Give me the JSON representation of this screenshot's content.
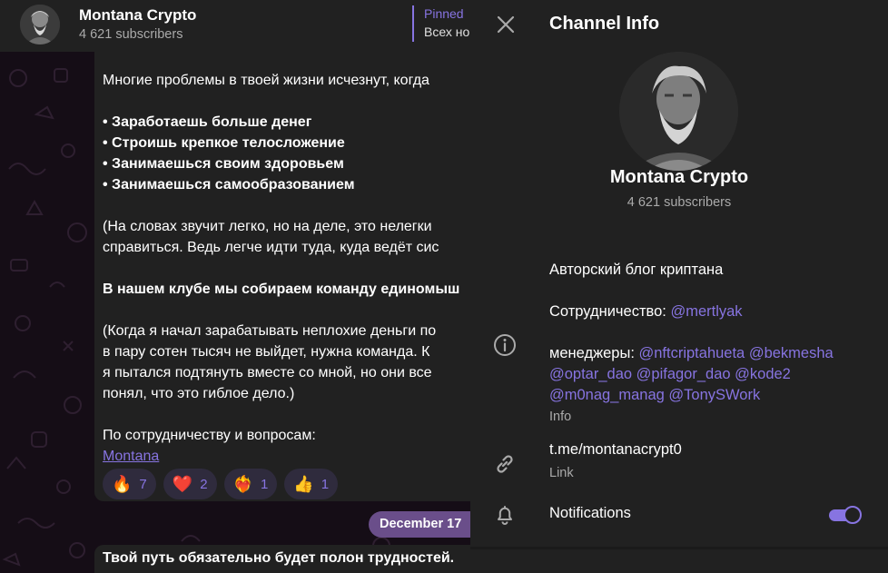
{
  "header": {
    "title": "Montana Crypto",
    "subscribers": "4 621 subscribers",
    "pinned_label": "Pinned",
    "pinned_text": "Всех но"
  },
  "message": {
    "lines": [
      {
        "text": "Многие проблемы в твоей жизни исчезнут, когда",
        "bold": false
      },
      {
        "text": "",
        "bold": false
      },
      {
        "text": "• Заработаешь больше денег",
        "bold": true
      },
      {
        "text": "• Строишь крепкое телосложение",
        "bold": true
      },
      {
        "text": "• Занимаешься своим здоровьем",
        "bold": true
      },
      {
        "text": "• Занимаешься самообразованием",
        "bold": true
      },
      {
        "text": "",
        "bold": false
      },
      {
        "text": "(На словах звучит легко, но на деле, это нелегки",
        "bold": false
      },
      {
        "text": "справиться. Ведь легче идти туда, куда ведёт сис",
        "bold": false
      },
      {
        "text": "",
        "bold": false
      },
      {
        "text": "В нашем клубе мы собираем команду единомыш",
        "bold": true
      },
      {
        "text": "",
        "bold": false
      },
      {
        "text": "(Когда я начал зарабатывать неплохие деньги по",
        "bold": false
      },
      {
        "text": "в пару сотен тысяч не выйдет, нужна команда. К",
        "bold": false
      },
      {
        "text": "я пытался подтянуть вместе со мной, но они все",
        "bold": false
      },
      {
        "text": "понял, что это гиблое дело.)",
        "bold": false
      },
      {
        "text": "",
        "bold": false
      },
      {
        "text": "По сотрудничеству и вопросам:",
        "bold": false
      }
    ],
    "link": "Montana",
    "reactions": [
      {
        "emoji": "🔥",
        "count": "7"
      },
      {
        "emoji": "❤️",
        "count": "2"
      },
      {
        "emoji": "❤️‍🔥",
        "count": "1"
      },
      {
        "emoji": "👍",
        "count": "1"
      }
    ]
  },
  "date_pill": "December 17",
  "message2": "Твой путь обязательно будет полон трудностей.",
  "panel": {
    "title": "Channel Info",
    "channel_name": "Montana Crypto",
    "subscribers": "4 621 subscribers",
    "description": "Авторский блог криптана",
    "cooperation_prefix": "Сотрудничество: ",
    "cooperation_mention": "@mertlyak",
    "managers_prefix": "менеджеры: ",
    "managers_line1": "@nftcriptahueta @bekmesha",
    "managers_line2": "@optar_dao @pifagor_dao @kode2",
    "managers_line3": "@m0nag_manag @TonySWork",
    "info_caption": "Info",
    "link": "t.me/montanacrypt0",
    "link_caption": "Link",
    "notifications_label": "Notifications",
    "notifications_enabled": true
  },
  "colors": {
    "accent": "#8774e1",
    "panel_bg": "#212121",
    "chat_bg": "#150d16",
    "date_pill": "#6a4e8a"
  }
}
